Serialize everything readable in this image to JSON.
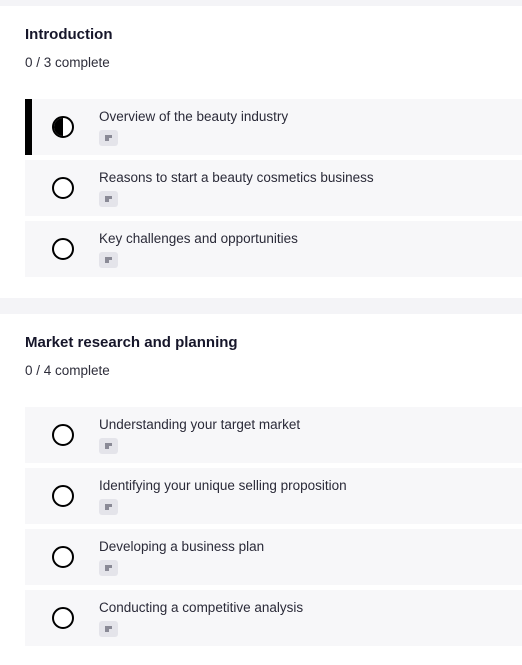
{
  "sections": [
    {
      "title": "Introduction",
      "progress": "0 / 3 complete",
      "lessons": [
        {
          "title": "Overview of the beauty industry",
          "status": "in-progress",
          "type_icon": "text-lesson-icon"
        },
        {
          "title": "Reasons to start a beauty cosmetics business",
          "status": "not-started",
          "type_icon": "text-lesson-icon"
        },
        {
          "title": "Key challenges and opportunities",
          "status": "not-started",
          "type_icon": "text-lesson-icon"
        }
      ]
    },
    {
      "title": "Market research and planning",
      "progress": "0 / 4 complete",
      "lessons": [
        {
          "title": "Understanding your target market",
          "status": "not-started",
          "type_icon": "text-lesson-icon"
        },
        {
          "title": "Identifying your unique selling proposition",
          "status": "not-started",
          "type_icon": "text-lesson-icon"
        },
        {
          "title": "Developing a business plan",
          "status": "not-started",
          "type_icon": "text-lesson-icon"
        },
        {
          "title": "Conducting a competitive analysis",
          "status": "not-started",
          "type_icon": "text-lesson-icon"
        }
      ]
    }
  ],
  "colors": {
    "page_background": "#f4f4f7",
    "card_background": "#ffffff",
    "lesson_background": "#f7f7f9",
    "active_indicator": "#000000",
    "badge_background": "#e4e4ea",
    "badge_glyph": "#8a8a96"
  }
}
